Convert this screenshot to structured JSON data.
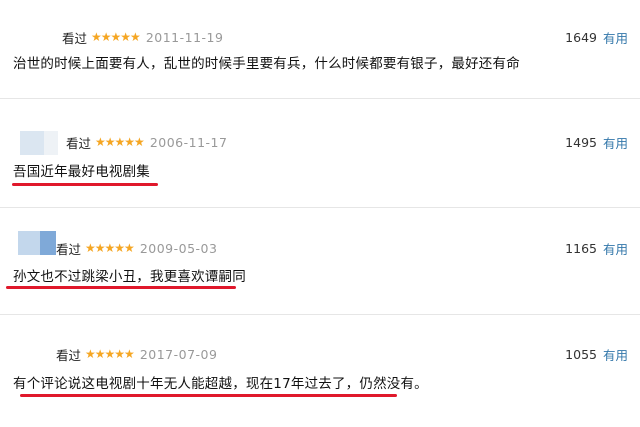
{
  "reviews": [
    {
      "status": "看过",
      "stars": "★★★★★",
      "date": "2011-11-19",
      "votes": "1649",
      "useful_label": "有用",
      "text": "治世的时候上面要有人，乱世的时候手里要有兵，什么时候都要有银子，最好还有命",
      "underlined": false
    },
    {
      "status": "看过",
      "stars": "★★★★★",
      "date": "2006-11-17",
      "votes": "1495",
      "useful_label": "有用",
      "text": "吾国近年最好电视剧集",
      "underlined": true
    },
    {
      "status": "看过",
      "stars": "★★★★★",
      "date": "2009-05-03",
      "votes": "1165",
      "useful_label": "有用",
      "text": "孙文也不过跳梁小丑，我更喜欢谭嗣同",
      "underlined": true
    },
    {
      "status": "看过",
      "stars": "★★★★★",
      "date": "2017-07-09",
      "votes": "1055",
      "useful_label": "有用",
      "text": "有个评论说这电视剧十年无人能超越，现在17年过去了，仍然没有。",
      "underlined": true
    }
  ],
  "colors": {
    "star": "#f5a623",
    "useful_link": "#3377aa",
    "underline_mark": "#e0182b",
    "date": "#999999"
  },
  "icons": {
    "rating": "star-icon",
    "avatar": "blurred-avatar"
  }
}
